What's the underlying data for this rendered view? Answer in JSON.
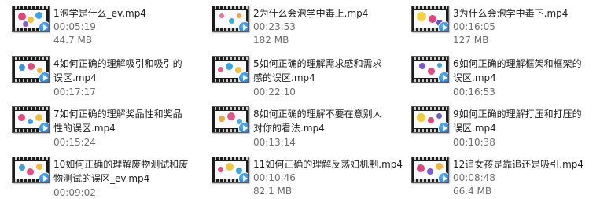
{
  "files": [
    {
      "name": "1泡学是什么_ev.mp4",
      "duration": "00:05:19",
      "size": "44.7 MB"
    },
    {
      "name": "2为什么会泡学中毒上.mp4",
      "duration": "00:23:53",
      "size": "182 MB"
    },
    {
      "name": "3为什么会泡学中毒下.mp4",
      "duration": "00:16:05",
      "size": "127 MB"
    },
    {
      "name": "4如何正确的理解吸引和吸引的误区.mp4",
      "duration": "00:17:17",
      "size": ""
    },
    {
      "name": "5如何正确的理解需求感和需求感的误区.mp4",
      "duration": "00:22:10",
      "size": ""
    },
    {
      "name": "6如何正确的理解框架和框架的误区.mp4",
      "duration": "00:16:53",
      "size": ""
    },
    {
      "name": "7如何正确的理解奖品性和奖品性的误区.mp4",
      "duration": "00:15:24",
      "size": ""
    },
    {
      "name": "8如何正确的理解不要在意别人对你的看法.mp4",
      "duration": "00:13:14",
      "size": ""
    },
    {
      "name": "9如何正确的理解打压和打压的误区.mp4",
      "duration": "00:10:38",
      "size": ""
    },
    {
      "name": "10如何正确的理解废物测试和废物测试的误区_ev.mp4",
      "duration": "00:09:02",
      "size": ""
    },
    {
      "name": "11如何正确的理解反荡妇机制.mp4",
      "duration": "00:10:46",
      "size": "82.1 MB"
    },
    {
      "name": "12追女孩是靠追还是吸引.mp4",
      "duration": "00:08:48",
      "size": "66.4 MB"
    }
  ]
}
